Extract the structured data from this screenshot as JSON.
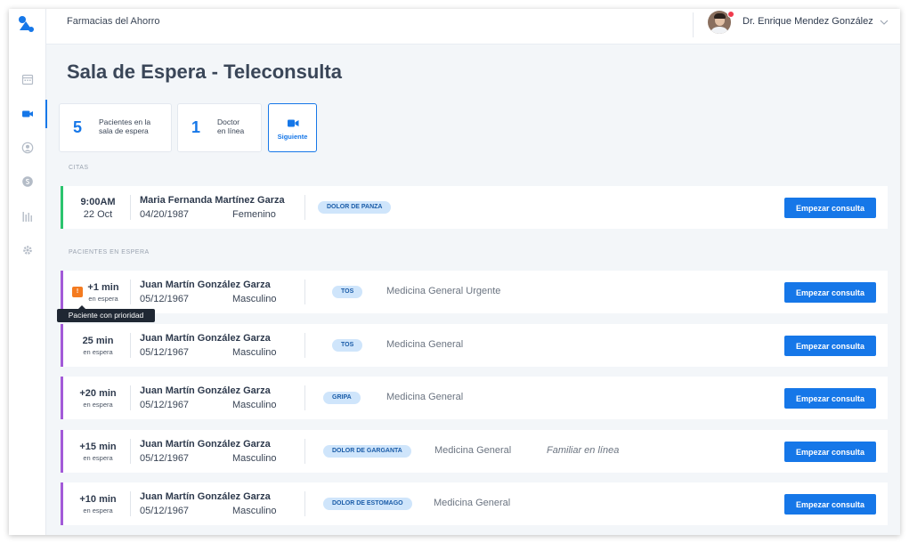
{
  "header": {
    "pharmacy": "Farmacias del Ahorro",
    "doctor_name": "Dr. Enrique Mendez González"
  },
  "page": {
    "title": "Sala de Espera - Teleconsulta"
  },
  "stats": {
    "waiting_count": "5",
    "waiting_label_1": "Pacientes en la",
    "waiting_label_2": "sala de espera",
    "doctors_count": "1",
    "doctors_label_1": "Doctor",
    "doctors_label_2": "en línea",
    "next_label": "Siguiente"
  },
  "sections": {
    "appointments": "CITAS",
    "waiting": "PACIENTES EN ESPERA"
  },
  "appointment": {
    "time": "9:00AM",
    "date": "22 Oct",
    "name": "Maria Fernanda Martínez Garza",
    "dob": "04/20/1987",
    "gender": "Femenino",
    "tag": "DOLOR DE PANZA",
    "button": "Empezar consulta",
    "bar_color": "#2bc46e"
  },
  "waiting_patients": [
    {
      "wait": "+1 min",
      "wait_sub": "en espera",
      "priority": "!",
      "name": "Juan Martín González Garza",
      "dob": "05/12/1967",
      "gender": "Masculino",
      "tag": "TOS",
      "specialty": "Medicina General Urgente",
      "familiar": "",
      "button": "Empezar consulta"
    },
    {
      "wait": "25 min",
      "wait_sub": "en espera",
      "priority": "",
      "name": "Juan Martín González Garza",
      "dob": "05/12/1967",
      "gender": "Masculino",
      "tag": "TOS",
      "specialty": "Medicina General",
      "familiar": "",
      "button": "Empezar consulta"
    },
    {
      "wait": "+20 min",
      "wait_sub": "en espera",
      "priority": "",
      "name": "Juan Martín González Garza",
      "dob": "05/12/1967",
      "gender": "Masculino",
      "tag": "GRIPA",
      "specialty": "Medicina General",
      "familiar": "",
      "button": "Empezar consulta"
    },
    {
      "wait": "+15 min",
      "wait_sub": "en espera",
      "priority": "",
      "name": "Juan Martín González Garza",
      "dob": "05/12/1967",
      "gender": "Masculino",
      "tag": "DOLOR DE GARGANTA",
      "specialty": "Medicina General",
      "familiar": "Familiar en línea",
      "button": "Empezar consulta"
    },
    {
      "wait": "+10 min",
      "wait_sub": "en espera",
      "priority": "",
      "name": "Juan Martín González Garza",
      "dob": "05/12/1967",
      "gender": "Masculino",
      "tag": "DOLOR DE ESTOMAGO",
      "specialty": "Medicina General",
      "familiar": "",
      "button": "Empezar consulta"
    }
  ],
  "tooltip": "Paciente con prioridad",
  "colors": {
    "accent": "#1677e8",
    "waiting_bar": "#a35ad8",
    "appointment_bar": "#2bc46e",
    "priority": "#f47b20"
  },
  "icons": {
    "sidebar": [
      "calendar-icon",
      "video-icon",
      "user-icon",
      "billing-icon",
      "stats-icon",
      "gear-icon"
    ],
    "header": [
      "avatar",
      "chevron-down-icon"
    ]
  }
}
